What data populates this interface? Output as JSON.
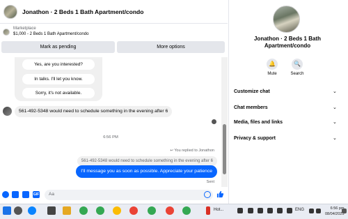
{
  "header": {
    "title": "Jonathon · 2 Beds 1 Bath Apartment/condo"
  },
  "listing": {
    "label": "Marketplace",
    "price_line": "$1,000 - 2 Beds 1 Bath Apartment/condo"
  },
  "actions": {
    "pending": "Mark as pending",
    "more": "More options"
  },
  "quick_replies": [
    "Yes, are you interested?",
    "In talks. I'll let you know.",
    "Sorry, it's not available."
  ],
  "messages": {
    "incoming": "561-492-5348 would need to schedule something in the evening after 6",
    "time": "6:56 PM",
    "replied_label": "You replied to Jonathon",
    "quoted": "561-492-5348 would need to schedule something in the evening after 6",
    "outgoing": "I'll message you as soon as possible. Appreciate your patience",
    "status": "Sent"
  },
  "composer": {
    "placeholder": "Aa"
  },
  "panel": {
    "title": "Jonathon · 2 Beds 1 Bath Apartment/condo",
    "mute": "Mute",
    "search": "Search",
    "items": [
      "Customize chat",
      "Chat members",
      "Media, files and links",
      "Privacy & support"
    ]
  },
  "taskbar": {
    "weather": "Hot...",
    "lang": "ENG",
    "time": "6:56 pm",
    "date": "08/04/2025"
  },
  "colors": {
    "accent": "#0866ff",
    "bubble_in": "#f0f0f0",
    "panel_bg": "#ffffff"
  }
}
